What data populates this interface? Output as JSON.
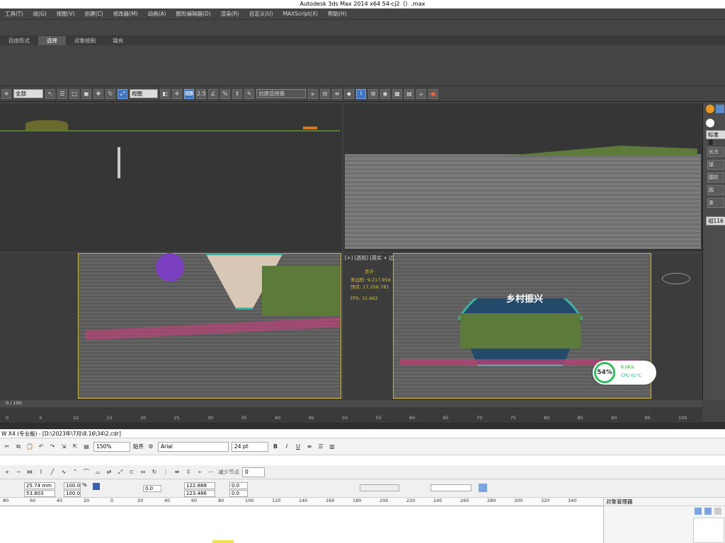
{
  "max_window": {
    "title": "Autodesk 3ds Max  2014 x64       54-cj2（）.max",
    "menu": [
      "工具(T)",
      "组(G)",
      "视图(V)",
      "创建(C)",
      "修改器(M)",
      "动画(A)",
      "图形编辑器(D)",
      "渲染(R)",
      "自定义(U)",
      "MAXScript(X)",
      "帮助(H)"
    ],
    "ribbon_tabs": [
      "自由形式",
      "选择",
      "对象绘制",
      "填充"
    ],
    "active_ribbon_tab": "选择",
    "toolbar": {
      "selection_filter": "全部",
      "coord_system": "视图",
      "snap_label": "2.5",
      "named_selection": "创建选择集"
    },
    "viewports": {
      "perspective_label": "[+] [透视] [真实 + 边面]",
      "stats_total_label": "总计",
      "stats_polys": "多边形: 9,217,956",
      "stats_verts": "顶点: 17,256,781",
      "fps": "FPS:    31.662",
      "sign_text": "乡村振兴"
    },
    "command_panel": {
      "dropdown": "标准基",
      "items": [
        "长方",
        "球",
        "圆柱",
        "圆",
        "茶"
      ],
      "name_field": "组116"
    },
    "timeline": {
      "frame_counter": "0 / 100",
      "ticks": [
        "0",
        "5",
        "10",
        "15",
        "20",
        "25",
        "30",
        "35",
        "40",
        "45",
        "50",
        "55",
        "60",
        "65",
        "70",
        "75",
        "80",
        "85",
        "90",
        "95",
        "100"
      ]
    },
    "perf_widget": {
      "percent": "54%",
      "net_speed": "6.2K/s",
      "cpu": "CPU 61°C"
    }
  },
  "coreldraw": {
    "title": "W X4 (专业版) - [D:\\2023年\\7月\\8.16\\34\\2.cdr]",
    "zoom": "150%",
    "snap_label": "贴齐",
    "font_name": "Arial",
    "font_size": "24 pt",
    "reduce_nodes_label": "减少节点",
    "reduce_nodes_value": "0",
    "props": {
      "x": "25.74 mm",
      "y": "53.803 mm",
      "scale_w": "100.0",
      "scale_h": "100.0",
      "pct": "%",
      "angle": "0.0",
      "w": "122.888 mm",
      "h": "223.486 mm",
      "rot_a": "0.0",
      "rot_b": "0.0"
    },
    "ruler_ticks": [
      "80",
      "60",
      "40",
      "20",
      "0",
      "20",
      "40",
      "60",
      "80",
      "100",
      "120",
      "140",
      "160",
      "180",
      "200",
      "220",
      "240",
      "260",
      "280",
      "300",
      "320",
      "340"
    ],
    "object_manager_title": "对象管理器"
  },
  "colors": {
    "max_bg": "#444444",
    "viewport_border_active": "#d6c24a",
    "accent_blue": "#3f74c0"
  }
}
